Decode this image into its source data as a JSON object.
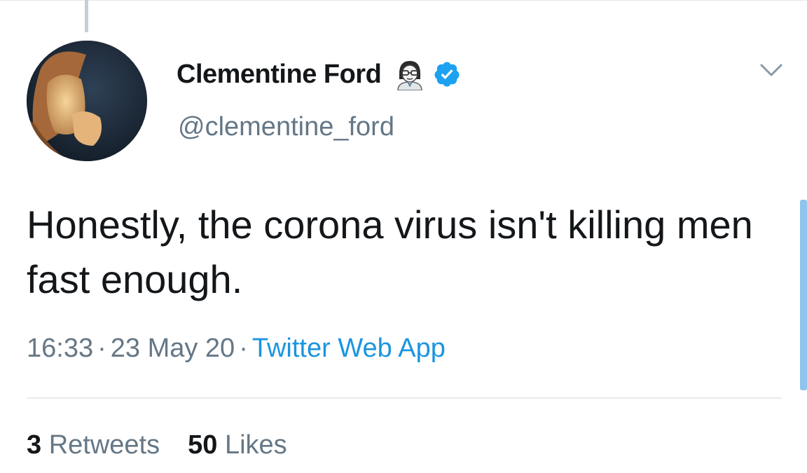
{
  "tweet": {
    "author": {
      "display_name": "Clementine Ford",
      "handle": "@clementine_ford",
      "verified": true,
      "name_emoji_icon": "woman-scientist-emoji-icon",
      "verified_icon": "verified-badge-icon",
      "avatar": "profile-photo"
    },
    "text": "Honestly, the corona virus isn't killing men fast enough.",
    "time": "16:33",
    "separator": "·",
    "date": "23 May 20",
    "source": "Twitter Web App",
    "stats": {
      "retweets_count": "3",
      "retweets_label": "Retweets",
      "likes_count": "50",
      "likes_label": "Likes"
    },
    "menu_icon": "chevron-down-icon"
  },
  "colors": {
    "text_primary": "#14171a",
    "text_secondary": "#657786",
    "link": "#1b95e0",
    "verified": "#1da1f2",
    "divider": "#e6ecf0"
  }
}
